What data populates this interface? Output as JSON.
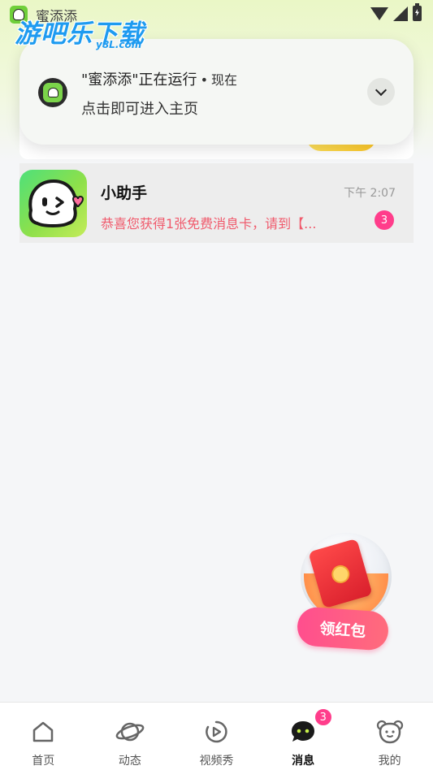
{
  "status_bar": {
    "app_name": "蜜添添",
    "icons": [
      "wifi-icon",
      "signal-icon",
      "battery-icon"
    ]
  },
  "watermark": {
    "main": "游吧乐下载",
    "sub": "y8L.com"
  },
  "notification": {
    "title": "\"蜜添添\"正在运行",
    "separator": "•",
    "time": "现在",
    "body": "点击即可进入主页",
    "expand_icon": "chevron-down-icon"
  },
  "chat_list": [
    {
      "name": "小助手",
      "time": "下午 2:07",
      "preview": "恭喜您获得1张免费消息卡，请到【...",
      "unread": "3"
    }
  ],
  "red_packet": {
    "label": "领红包"
  },
  "bottom_nav": {
    "items": [
      {
        "label": "首页",
        "icon": "home-icon"
      },
      {
        "label": "动态",
        "icon": "planet-icon"
      },
      {
        "label": "视频秀",
        "icon": "play-icon"
      },
      {
        "label": "消息",
        "icon": "chat-bubble-icon",
        "badge": "3",
        "active": true
      },
      {
        "label": "我的",
        "icon": "bear-face-icon"
      }
    ]
  },
  "colors": {
    "accent_pink": "#ff3d8b",
    "preview_red": "#f05a6c",
    "header_green": "#eaf7c6"
  }
}
